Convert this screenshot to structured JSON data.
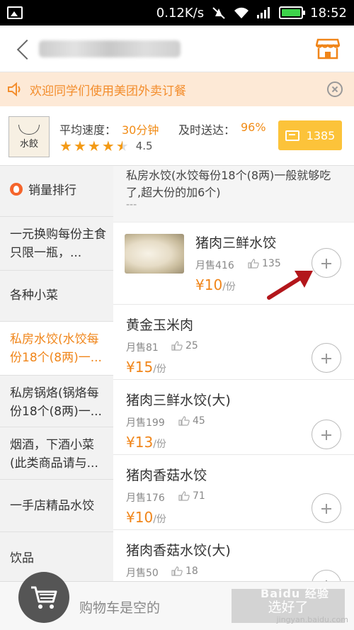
{
  "status_bar": {
    "speed": "0.12K/s",
    "time": "18:52"
  },
  "header": {
    "title_blurred": "",
    "store_icon": "storefront-icon"
  },
  "notice": {
    "text": "欢迎同学们使用美团外卖订餐"
  },
  "shop": {
    "logo_text": "水餃",
    "avg_speed_label": "平均速度：",
    "avg_speed_value": "30分钟",
    "ontime_label": "及时送达：",
    "ontime_value": "96%",
    "rating": "4.5",
    "rating_stars": 4.5,
    "reviews_count": "1385"
  },
  "sidebar": {
    "items": [
      {
        "label": "销量排行"
      },
      {
        "label": "一元换购每份主食只限一瓶，..."
      },
      {
        "label": "各种小菜"
      },
      {
        "label": "私房水饺(水饺每份18个(8两)一..."
      },
      {
        "label": "私房锅烙(锅烙每份18个(8两)一..."
      },
      {
        "label": "烟酒，下酒小菜(此类商品请与..."
      },
      {
        "label": "一手店精品水饺"
      },
      {
        "label": "饮品"
      }
    ]
  },
  "main": {
    "description": "私房水饺(水饺每份18个(8两)一般就够吃了,超大份的加6个)",
    "description_more": "---",
    "items": [
      {
        "name": "猪肉三鲜水饺",
        "sold": "月售416",
        "likes": "135",
        "price": "¥10",
        "unit": "/份"
      },
      {
        "name": "黄金玉米肉",
        "sold": "月售81",
        "likes": "25",
        "price": "¥15",
        "unit": "/份"
      },
      {
        "name": "猪肉三鲜水饺(大)",
        "sold": "月售199",
        "likes": "45",
        "price": "¥13",
        "unit": "/份"
      },
      {
        "name": "猪肉香菇水饺",
        "sold": "月售176",
        "likes": "71",
        "price": "¥10",
        "unit": "/份"
      },
      {
        "name": "猪肉香菇水饺(大)",
        "sold": "月售50",
        "likes": "18",
        "price": "",
        "unit": ""
      }
    ]
  },
  "bottom_bar": {
    "cart_text": "购物车是空的",
    "checkout_label": "选好了",
    "watermark": "Baidu 经验",
    "watermark_url": "jingyan.baidu.com"
  },
  "colors": {
    "accent": "#f08519",
    "notice_bg": "#fde9d6",
    "review_btn": "#fcc33a"
  }
}
